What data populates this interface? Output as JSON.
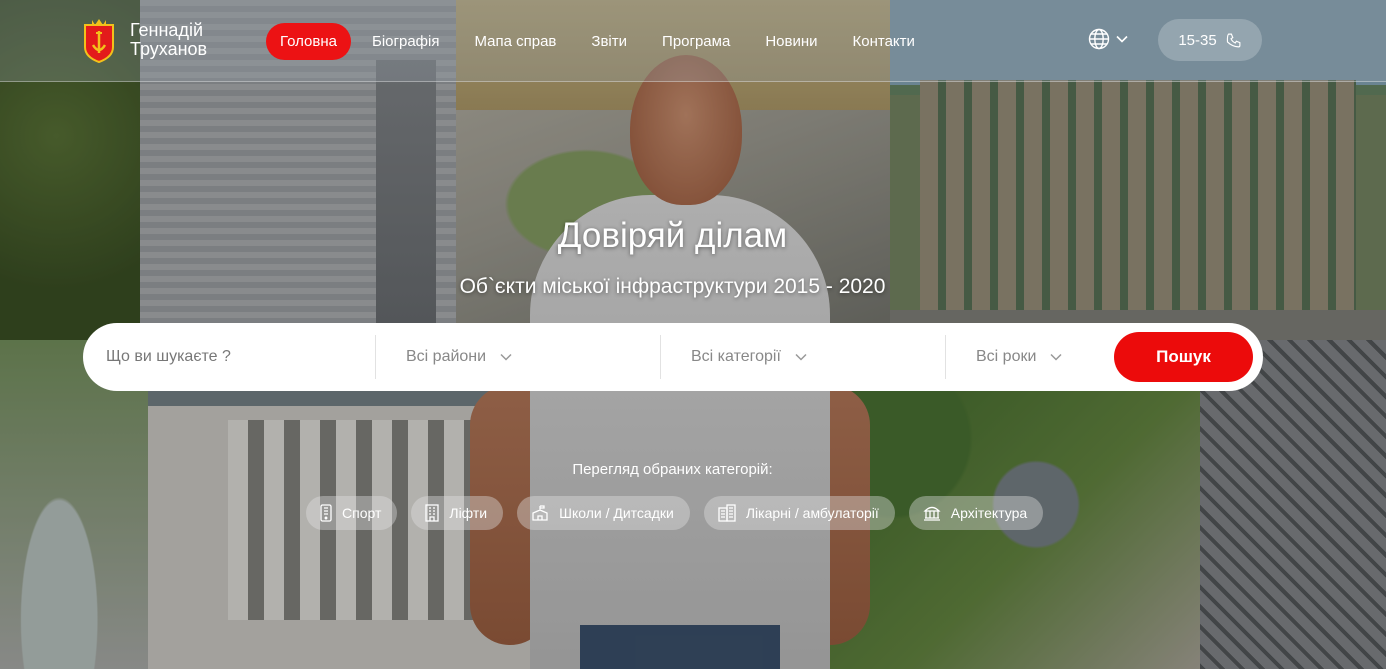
{
  "header": {
    "logo_line1": "Геннадій",
    "logo_line2": "Труханов",
    "nav": [
      {
        "label": "Головна",
        "active": true
      },
      {
        "label": "Біографія"
      },
      {
        "label": "Мапа справ"
      },
      {
        "label": "Звіти"
      },
      {
        "label": "Програма"
      },
      {
        "label": "Новини"
      },
      {
        "label": "Контакти"
      }
    ],
    "language_icon": "globe-icon",
    "phone": "15-35",
    "phone_icon": "phone-icon"
  },
  "hero": {
    "title": "Довіряй ділам",
    "subtitle": "Об`єкти міської інфраструктури 2015 - 2020"
  },
  "search": {
    "placeholder": "Що ви шукаєте ?",
    "districts": "Всі райони",
    "categories": "Всі категорії",
    "years": "Всі роки",
    "button": "Пошук"
  },
  "featured": {
    "title": "Перегляд обраних категорій:",
    "categories": [
      {
        "label": "Спорт",
        "icon": "phone-device-icon"
      },
      {
        "label": "Ліфти",
        "icon": "elevator-icon"
      },
      {
        "label": "Школи / Дитсадки",
        "icon": "school-icon"
      },
      {
        "label": "Лікарні / амбулаторії",
        "icon": "hospital-icon"
      },
      {
        "label": "Архітектура",
        "icon": "monument-icon"
      }
    ]
  },
  "colors": {
    "accent": "#EC1214",
    "white": "#FFFFFF"
  }
}
